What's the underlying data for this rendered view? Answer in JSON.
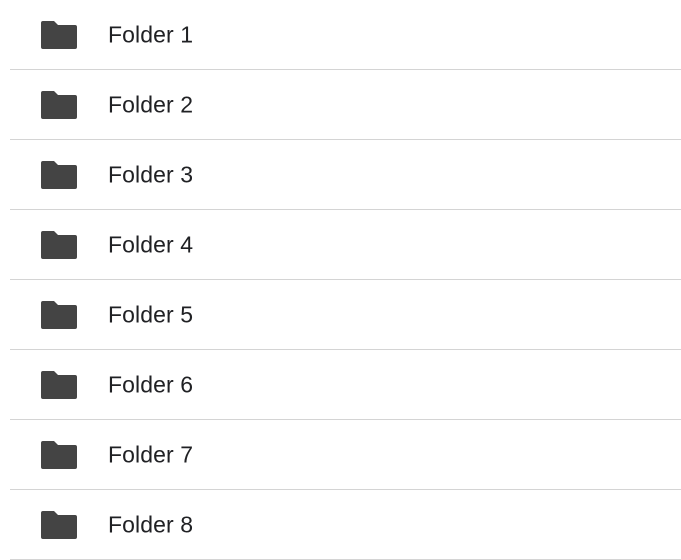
{
  "colors": {
    "folder_icon": "#444444",
    "text": "#202124",
    "divider": "#d4d4d4",
    "background": "#ffffff"
  },
  "folders": [
    {
      "label": "Folder 1",
      "icon": "folder-icon"
    },
    {
      "label": "Folder 2",
      "icon": "folder-icon"
    },
    {
      "label": "Folder 3",
      "icon": "folder-icon"
    },
    {
      "label": "Folder 4",
      "icon": "folder-icon"
    },
    {
      "label": "Folder 5",
      "icon": "folder-icon"
    },
    {
      "label": "Folder 6",
      "icon": "folder-icon"
    },
    {
      "label": "Folder 7",
      "icon": "folder-icon"
    },
    {
      "label": "Folder 8",
      "icon": "folder-icon"
    }
  ]
}
